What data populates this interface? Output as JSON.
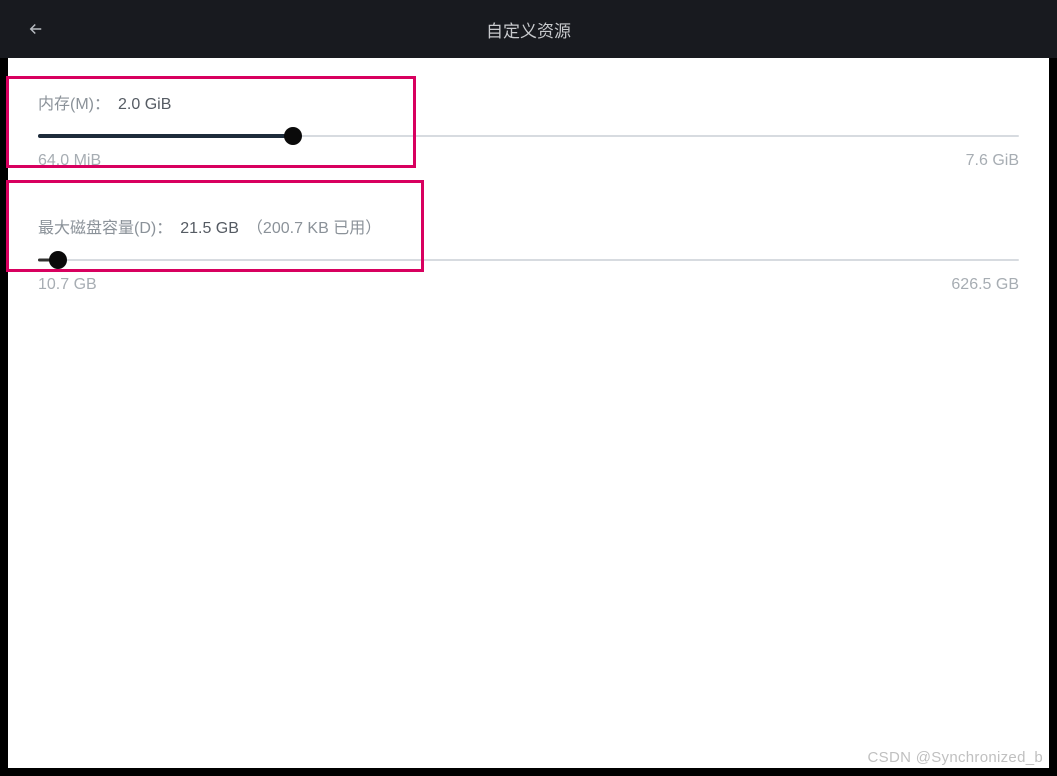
{
  "header": {
    "title": "自定义资源"
  },
  "memory": {
    "label": "内存(M)：",
    "value": "2.0 GiB",
    "min_label": "64.0 MiB",
    "max_label": "7.6 GiB",
    "fill_percent": 26
  },
  "disk": {
    "label": "最大磁盘容量(D)：",
    "value": "21.5 GB",
    "suffix": "（200.7 KB 已用）",
    "min_label": "10.7 GB",
    "max_label": "626.5 GB",
    "fill_percent": 2
  },
  "watermark": "CSDN @Synchronized_b"
}
